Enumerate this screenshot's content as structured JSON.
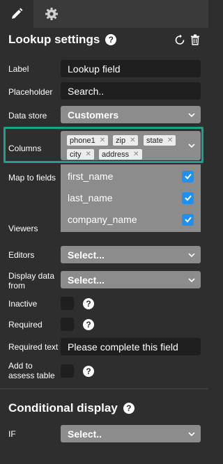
{
  "tabs": [
    {
      "icon": "pencil-icon",
      "active": true
    },
    {
      "icon": "gear-icon",
      "active": false
    }
  ],
  "header": {
    "title": "Lookup settings",
    "help": "?",
    "actions": [
      "refresh-icon",
      "trash-icon"
    ]
  },
  "fields": {
    "label": {
      "label": "Label",
      "value": "Lookup field"
    },
    "placeholder": {
      "label": "Placeholder",
      "value": "Search.."
    },
    "data_store": {
      "label": "Data store",
      "value": "Customers"
    },
    "columns": {
      "label": "Columns",
      "tags": [
        "phone1",
        "zip",
        "state",
        "city",
        "address"
      ]
    },
    "map_to_fields": {
      "label": "Map to fields",
      "items": [
        {
          "name": "first_name",
          "checked": true
        },
        {
          "name": "last_name",
          "checked": true
        },
        {
          "name": "company_name",
          "checked": true
        }
      ]
    },
    "viewers": {
      "label": "Viewers"
    },
    "editors": {
      "label": "Editors",
      "value": "Select..."
    },
    "display_data_from": {
      "label_line1": "Display data",
      "label_line2": "from",
      "value": "Select..."
    },
    "inactive": {
      "label": "Inactive",
      "help": "?"
    },
    "required": {
      "label": "Required",
      "help": "?"
    },
    "required_text": {
      "label": "Required text",
      "value": "Please complete this field"
    },
    "add_to_assess_table": {
      "label_line1": "Add to",
      "label_line2": "assess table",
      "help": "?"
    }
  },
  "conditional": {
    "title": "Conditional display",
    "help": "?",
    "if_label": "IF",
    "if_value": "Select.."
  },
  "colors": {
    "background": "#2e2e2e",
    "highlight": "#1aa38a",
    "checkbox": "#1f8ff0",
    "select_bg": "#8c8c8c",
    "input_bg": "#1f1f1f"
  }
}
